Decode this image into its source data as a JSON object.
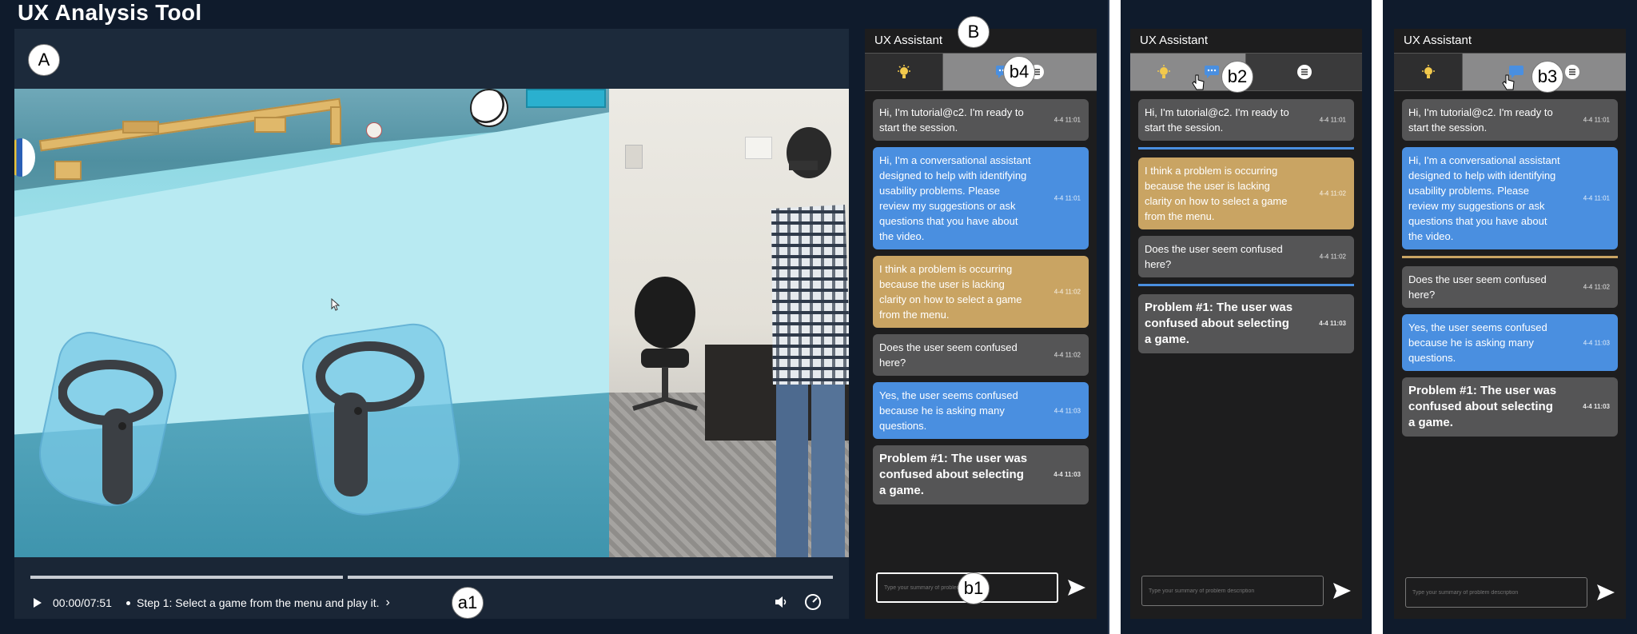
{
  "app": {
    "title": "UX Analysis Tool"
  },
  "video": {
    "current_time": "00:00",
    "duration": "07:51",
    "time_sep": "/",
    "step_text": "Step 1: Select a game from the menu and play it.",
    "progress": 0.0
  },
  "labels": {
    "A": "A",
    "B": "B",
    "a1": "a1",
    "b1": "b1",
    "b2": "b2",
    "b3": "b3",
    "b4": "b4"
  },
  "assistant": {
    "title": "UX Assistant",
    "input_placeholder": "Type your summary of problem description",
    "colors": {
      "user_msg": "#555556",
      "assistant_msg": "#4a8fe0",
      "suggestion_msg": "#c9a463",
      "active_tab": "#8a8a8b",
      "divider_blue": "#4a8fe0",
      "divider_gold": "#c9a463"
    }
  },
  "messages": {
    "m1": {
      "text": "Hi, I'm tutorial@c2. I'm ready to start the session.",
      "ts": "4-4 11:01"
    },
    "m2": {
      "text": "Hi, I'm a conversational assistant designed to help with identifying usability problems. Please review my suggestions or ask questions that you have about the video.",
      "ts": "4-4 11:01"
    },
    "m3": {
      "text": "I think a problem is occurring because the user is lacking clarity on how to select a game from the menu.",
      "ts": "4-4 11:02"
    },
    "m4": {
      "text": "Does the user seem confused here?",
      "ts": "4-4 11:02"
    },
    "m5": {
      "text": "Yes, the user seems confused because he is asking many questions.",
      "ts": "4-4 11:03"
    },
    "m6": {
      "text": "Problem #1: The user was confused about selecting a game.",
      "ts": "4-4 11:03"
    }
  },
  "icons": {
    "suggestion_tab": "lightbulb-icon",
    "chat_tab": "chat-bubble-icon",
    "summary_tab": "list-icon",
    "send": "send-arrow-icon",
    "play": "play-icon",
    "volume": "volume-icon",
    "speed": "speedometer-icon"
  }
}
